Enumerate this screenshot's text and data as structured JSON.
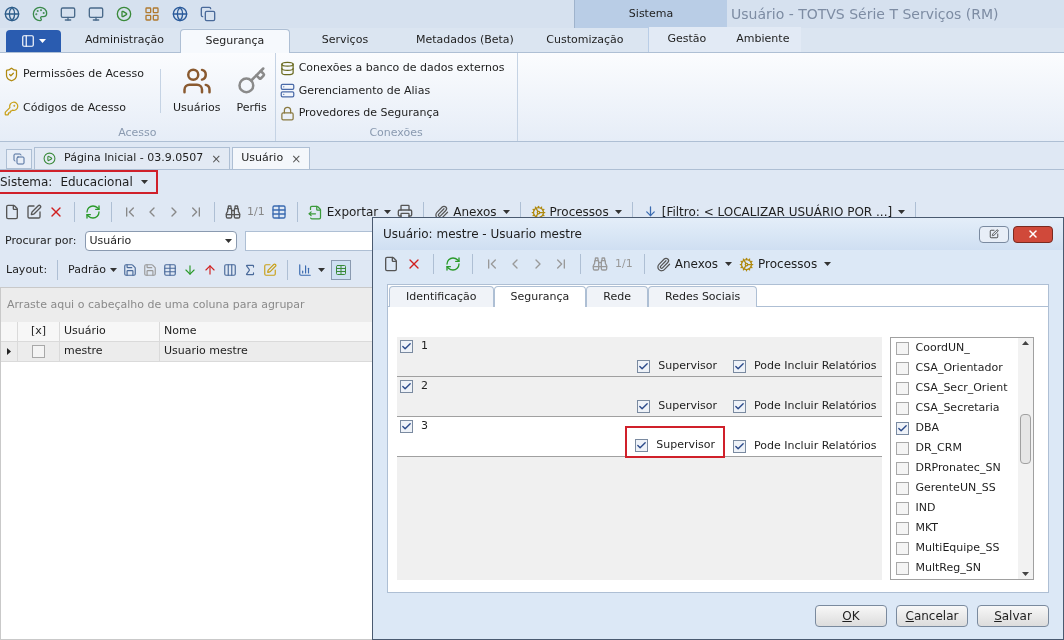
{
  "window": {
    "title": "Usuário - TOTVS Série T Serviços (RM)"
  },
  "context_group": {
    "label": "Sistema"
  },
  "ribbon_tabs": [
    {
      "label": "Administração",
      "selected": false
    },
    {
      "label": "Segurança",
      "selected": true
    },
    {
      "label": "Serviços",
      "selected": false
    },
    {
      "label": "Metadados (Beta)",
      "selected": false
    },
    {
      "label": "Customização",
      "selected": false
    }
  ],
  "context_tabs": [
    {
      "label": "Gestão",
      "selected": false
    },
    {
      "label": "Ambiente",
      "selected": false
    }
  ],
  "ribbon_groups": [
    {
      "label": "Acesso",
      "small_items": [
        "Permissões de Acesso",
        "Códigos de Acesso"
      ],
      "large_items": [
        "Usuários",
        "Perfis"
      ]
    },
    {
      "label": "Conexões",
      "small_items": [
        "Conexões a banco de dados externos",
        "Gerenciamento de Alias",
        "Provedores de Segurança"
      ]
    }
  ],
  "document_tabs": [
    {
      "label": "Página Inicial - 03.9.0507",
      "close": "×",
      "selected": false
    },
    {
      "label": "Usuário",
      "close": "×",
      "selected": true
    }
  ],
  "system_selector": {
    "label": "Sistema:",
    "value": "Educacional",
    "highlighted": true
  },
  "main_toolbar": {
    "record_counter": "1/1",
    "items": [
      "Exportar",
      "Anexos",
      "Processos",
      "[Filtro: < LOCALIZAR USUÁRIO POR ...]"
    ]
  },
  "search": {
    "label": "Procurar por:",
    "field": "Usuário"
  },
  "layout_bar": {
    "label": "Layout:",
    "value": "Padrão"
  },
  "group_panel": {
    "hint": "Arraste aqui o cabeçalho de uma coluna para agrupar"
  },
  "grid": {
    "checkbox_column": "[x]",
    "columns": [
      "Usuário",
      "Nome"
    ],
    "rows": [
      {
        "checked": false,
        "selected": true,
        "cells": [
          "mestre",
          "Usuario mestre"
        ]
      }
    ]
  },
  "dialog": {
    "title": "Usuário: mestre - Usuario mestre",
    "toolbar": {
      "record_counter": "1/1",
      "items": [
        "Anexos",
        "Processos"
      ]
    },
    "tabs": [
      {
        "label": "Identificação",
        "selected": false
      },
      {
        "label": "Segurança",
        "selected": true
      },
      {
        "label": "Rede",
        "selected": false
      },
      {
        "label": "Redes Sociais",
        "selected": false
      }
    ],
    "entries": [
      {
        "label": "1",
        "checked": true,
        "selected": false,
        "supervisor": {
          "label": "Supervisor",
          "checked": true,
          "highlighted": false
        },
        "reports": {
          "label": "Pode Incluir Relatórios",
          "checked": true
        }
      },
      {
        "label": "2",
        "checked": true,
        "selected": false,
        "supervisor": {
          "label": "Supervisor",
          "checked": true,
          "highlighted": false
        },
        "reports": {
          "label": "Pode Incluir Relatórios",
          "checked": true
        }
      },
      {
        "label": "3",
        "checked": true,
        "selected": true,
        "supervisor": {
          "label": "Supervisor",
          "checked": true,
          "highlighted": true
        },
        "reports": {
          "label": "Pode Incluir Relatórios",
          "checked": true
        }
      }
    ],
    "profiles": [
      {
        "label": "CoordUN_",
        "checked": false
      },
      {
        "label": "CSA_Orientador",
        "checked": false
      },
      {
        "label": "CSA_Secr_Orient",
        "checked": false
      },
      {
        "label": "CSA_Secretaria",
        "checked": false
      },
      {
        "label": "DBA",
        "checked": true
      },
      {
        "label": "DR_CRM",
        "checked": false
      },
      {
        "label": "DRPronatec_SN",
        "checked": false
      },
      {
        "label": "GerenteUN_SS",
        "checked": false
      },
      {
        "label": "IND",
        "checked": false
      },
      {
        "label": "MKT",
        "checked": false
      },
      {
        "label": "MultiEquipe_SS",
        "checked": false
      },
      {
        "label": "MultReg_SN",
        "checked": false
      }
    ],
    "buttons": [
      "OK",
      "Cancelar",
      "Salvar"
    ]
  }
}
